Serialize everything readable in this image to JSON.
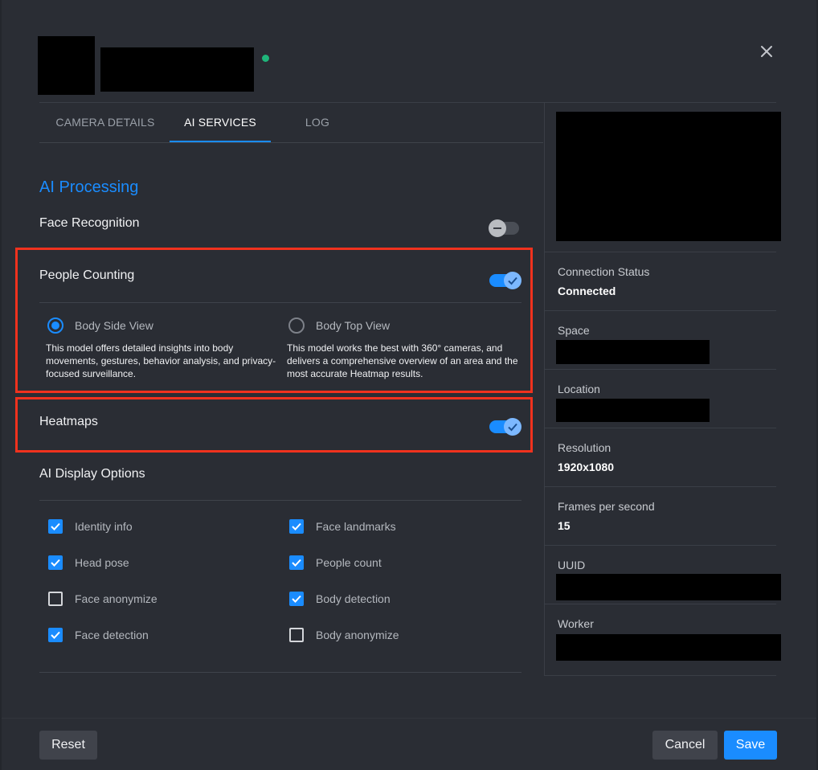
{
  "header": {
    "status_color": "#1fb57a",
    "close_icon": "close-icon"
  },
  "tabs": [
    {
      "label": "CAMERA DETAILS",
      "active": false
    },
    {
      "label": "AI SERVICES",
      "active": true
    },
    {
      "label": "LOG",
      "active": false
    }
  ],
  "ai_processing": {
    "title": "AI Processing",
    "face_recognition": {
      "label": "Face Recognition",
      "enabled": false
    },
    "people_counting": {
      "label": "People Counting",
      "enabled": true,
      "options": [
        {
          "label": "Body Side View",
          "selected": true,
          "description": "This model offers detailed insights into body movements, gestures, behavior analysis, and privacy-focused surveillance."
        },
        {
          "label": "Body Top View",
          "selected": false,
          "description": "This model works the best with 360° cameras, and delivers a comprehensive overview of an area and the most accurate Heatmap results."
        }
      ]
    },
    "heatmaps": {
      "label": "Heatmaps",
      "enabled": true
    }
  },
  "display_options": {
    "title": "AI Display Options",
    "items": [
      {
        "label": "Identity info",
        "checked": true
      },
      {
        "label": "Face landmarks",
        "checked": true
      },
      {
        "label": "Head pose",
        "checked": true
      },
      {
        "label": "People count",
        "checked": true
      },
      {
        "label": "Face anonymize",
        "checked": false
      },
      {
        "label": "Body detection",
        "checked": true
      },
      {
        "label": "Face detection",
        "checked": true
      },
      {
        "label": "Body anonymize",
        "checked": false
      }
    ]
  },
  "sidebar": {
    "connection_status": {
      "label": "Connection Status",
      "value": "Connected"
    },
    "space": {
      "label": "Space"
    },
    "location": {
      "label": "Location"
    },
    "resolution": {
      "label": "Resolution",
      "value": "1920x1080"
    },
    "fps": {
      "label": "Frames per second",
      "value": "15"
    },
    "uuid": {
      "label": "UUID"
    },
    "worker": {
      "label": "Worker"
    }
  },
  "footer": {
    "reset_label": "Reset",
    "cancel_label": "Cancel",
    "save_label": "Save"
  },
  "colors": {
    "accent": "#1a8cff",
    "highlight": "#f0321e",
    "background": "#2a2d34"
  }
}
